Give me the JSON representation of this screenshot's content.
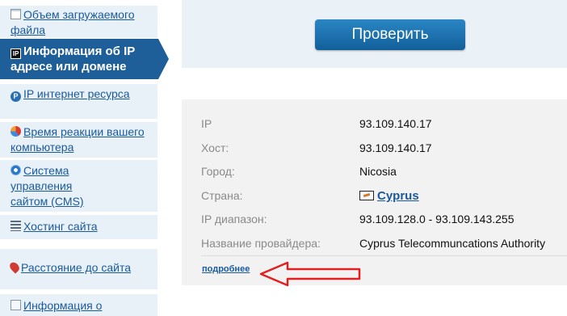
{
  "sidebar": {
    "items": [
      {
        "icon": "document-icon",
        "label": "Объем загружаемого файла"
      },
      {
        "icon": "ip-icon",
        "label": "Информация об IP адресе или домене"
      },
      {
        "icon": "ip-resource-icon",
        "label": "IP интернет ресурса"
      },
      {
        "icon": "reaction-time-icon",
        "label": "Время реакции вашего компьютера"
      },
      {
        "icon": "cms-icon",
        "label": "Система управления сайтом (CMS)"
      },
      {
        "icon": "hosting-icon",
        "label": "Хостинг сайта"
      },
      {
        "icon": "map-pin-icon",
        "label": "Расстояние до сайта"
      },
      {
        "icon": "info-icon",
        "label": "Информация о"
      }
    ]
  },
  "main": {
    "check_button": "Проверить",
    "info": {
      "rows": [
        {
          "key": "IP",
          "value": "93.109.140.17"
        },
        {
          "key": "Хост:",
          "value": "93.109.140.17"
        },
        {
          "key": "Город:",
          "value": "Nicosia"
        },
        {
          "key": "Страна:",
          "value": "Cyprus"
        },
        {
          "key": "IP диапазон:",
          "value": "93.109.128.0 - 93.109.143.255"
        },
        {
          "key": "Название провайдера:",
          "value": "Cyprus Telecommuncations Authority"
        }
      ],
      "more_link": "подробнее"
    }
  },
  "colors": {
    "accent": "#1f5f99",
    "link": "#1a5a9c",
    "annotation_arrow": "#e02020"
  }
}
